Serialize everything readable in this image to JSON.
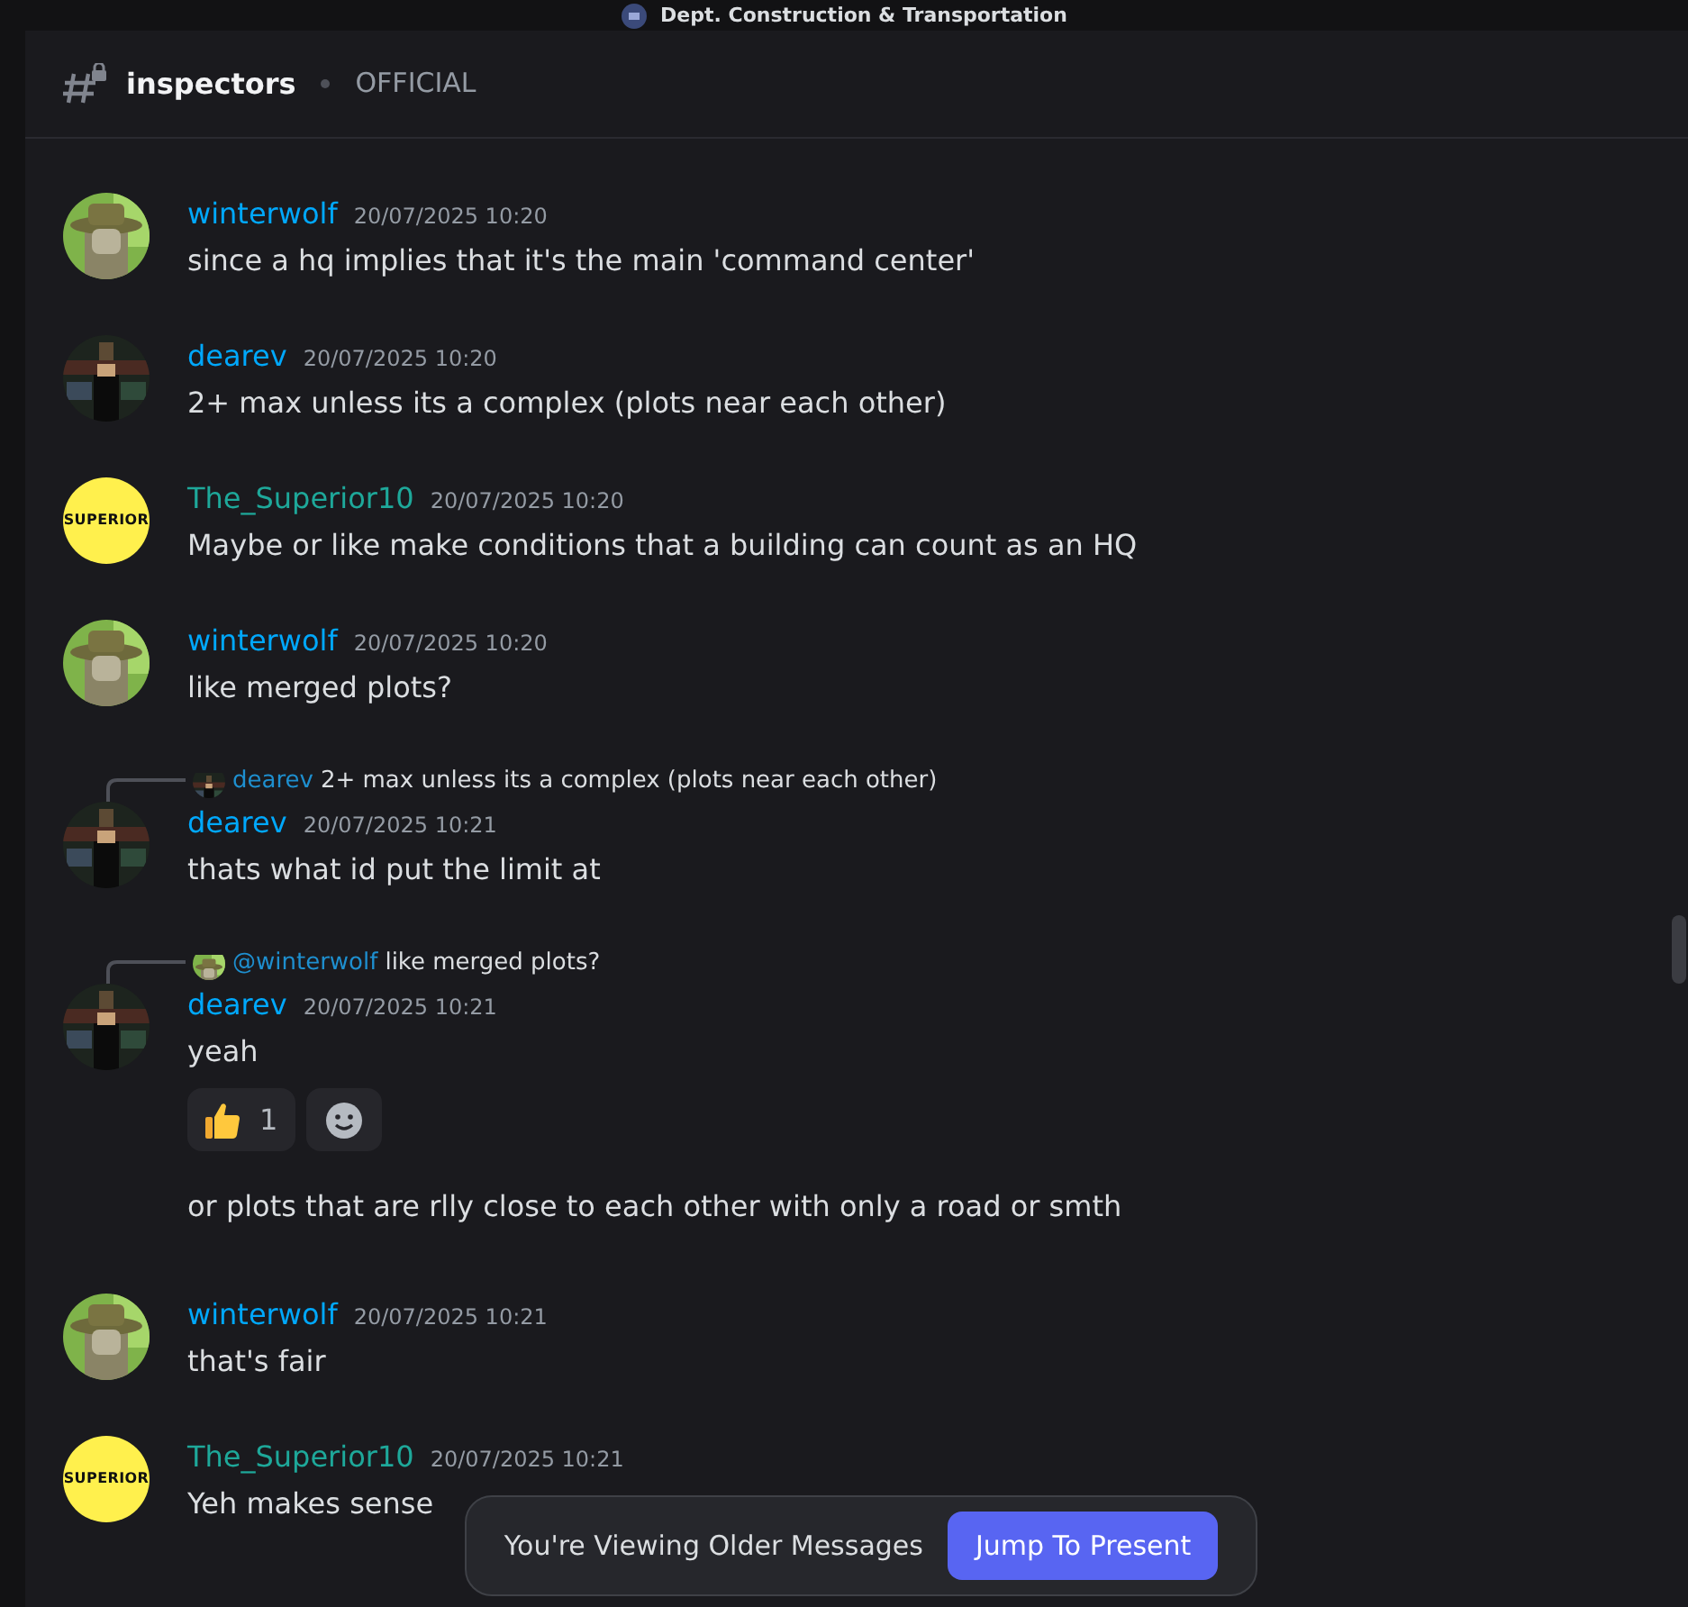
{
  "server_title": "Dept. Construction & Transportation",
  "channel": {
    "name": "inspectors",
    "tag": "OFFICIAL"
  },
  "messages": [
    {
      "kind": "message",
      "author": "winterwolf",
      "color": "#00a8fc",
      "avatar": {
        "kind": "hat"
      },
      "time": "20/07/2025 10:20",
      "text": "since a hq implies that it's the main 'command center'"
    },
    {
      "kind": "message",
      "author": "dearev",
      "color": "#00a8fc",
      "avatar": {
        "kind": "dark"
      },
      "time": "20/07/2025 10:20",
      "text": "2+ max unless its a complex (plots near each other)"
    },
    {
      "kind": "message",
      "author": "The_Superior10",
      "color": "#1ea89a",
      "avatar": {
        "kind": "badge",
        "label": "SUPERIOR"
      },
      "time": "20/07/2025 10:20",
      "text": "Maybe or like make conditions that a building can count as an HQ"
    },
    {
      "kind": "message",
      "author": "winterwolf",
      "color": "#00a8fc",
      "avatar": {
        "kind": "hat"
      },
      "time": "20/07/2025 10:20",
      "text": "like merged plots?"
    },
    {
      "kind": "message",
      "author": "dearev",
      "color": "#00a8fc",
      "avatar": {
        "kind": "dark"
      },
      "time": "20/07/2025 10:21",
      "text": "thats what id put the limit at",
      "reply_to": {
        "author": "dearev",
        "avatar": {
          "kind": "dark"
        },
        "text": "2+ max unless its a complex (plots near each other)"
      }
    },
    {
      "kind": "message",
      "author": "dearev",
      "color": "#00a8fc",
      "avatar": {
        "kind": "dark"
      },
      "time": "20/07/2025 10:21",
      "text": "yeah",
      "reply_to": {
        "author": "@winterwolf",
        "avatar": {
          "kind": "hat"
        },
        "text": "like merged plots?"
      },
      "reactions": [
        {
          "kind": "thumbs",
          "count": "1"
        }
      ],
      "add_reaction_button": true
    },
    {
      "kind": "continuation",
      "text": "or plots that are rlly close to each other with only a road or smth"
    },
    {
      "kind": "message",
      "author": "winterwolf",
      "color": "#00a8fc",
      "avatar": {
        "kind": "hat"
      },
      "time": "20/07/2025 10:21",
      "text": "that's fair"
    },
    {
      "kind": "message",
      "author": "The_Superior10",
      "color": "#1ea89a",
      "avatar": {
        "kind": "badge",
        "label": "SUPERIOR"
      },
      "time": "20/07/2025 10:21",
      "text": "Yeh makes sense"
    }
  ],
  "banner": {
    "text": "You're Viewing Older Messages",
    "button": "Jump To Present"
  }
}
